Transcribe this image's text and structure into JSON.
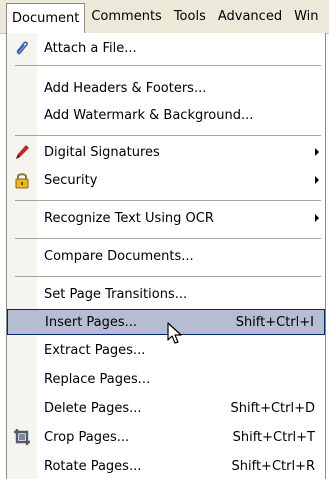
{
  "menubar": {
    "items": [
      {
        "label": "Document"
      },
      {
        "label": "Comments"
      },
      {
        "label": "Tools"
      },
      {
        "label": "Advanced"
      },
      {
        "label": "Win"
      }
    ]
  },
  "menu": {
    "items": [
      {
        "label": "Attach a File...",
        "icon": "paperclip-icon"
      },
      {
        "label": "Add Headers & Footers..."
      },
      {
        "label": "Add Watermark & Background..."
      },
      {
        "label": "Digital Signatures",
        "icon": "pen-icon",
        "submenu": true
      },
      {
        "label": "Security",
        "icon": "lock-icon",
        "submenu": true
      },
      {
        "label": "Recognize Text Using OCR",
        "submenu": true
      },
      {
        "label": "Compare Documents..."
      },
      {
        "label": "Set Page Transitions..."
      },
      {
        "label": "Insert Pages...",
        "shortcut": "Shift+Ctrl+I",
        "highlighted": true
      },
      {
        "label": "Extract Pages..."
      },
      {
        "label": "Replace Pages..."
      },
      {
        "label": "Delete Pages...",
        "shortcut": "Shift+Ctrl+D"
      },
      {
        "label": "Crop Pages...",
        "shortcut": "Shift+Ctrl+T",
        "icon": "crop-icon"
      },
      {
        "label": "Rotate Pages...",
        "shortcut": "Shift+Ctrl+R"
      }
    ]
  },
  "colors": {
    "menubar_bg": "#ece9d8",
    "highlight_bg": "#b6bdd2",
    "highlight_border": "#0a246a"
  }
}
